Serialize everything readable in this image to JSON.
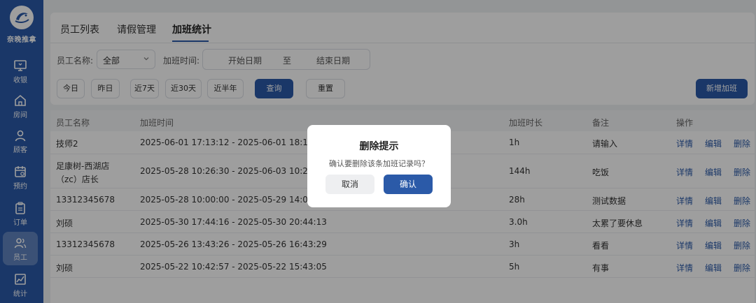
{
  "app": {
    "brand": "奈晚推拿"
  },
  "sidebar": {
    "items": [
      {
        "label": "收银",
        "icon": "monitor-icon"
      },
      {
        "label": "房间",
        "icon": "home-icon"
      },
      {
        "label": "顾客",
        "icon": "user-icon"
      },
      {
        "label": "预约",
        "icon": "calendar-icon"
      },
      {
        "label": "订单",
        "icon": "clipboard-icon"
      },
      {
        "label": "员工",
        "icon": "users-icon",
        "active": true
      },
      {
        "label": "统计",
        "icon": "chart-icon"
      }
    ]
  },
  "tabs": [
    {
      "label": "员工列表"
    },
    {
      "label": "请假管理"
    },
    {
      "label": "加班统计",
      "active": true
    }
  ],
  "filters": {
    "employee_label": "员工名称:",
    "employee_value": "全部",
    "time_label": "加班时间:",
    "start_placeholder": "开始日期",
    "range_sep": "至",
    "end_placeholder": "结束日期",
    "quick": [
      "今日",
      "昨日",
      "近7天",
      "近30天",
      "近半年"
    ],
    "query": "查询",
    "reset": "重置",
    "add": "新增加班"
  },
  "table": {
    "headers": [
      "员工名称",
      "加班时间",
      "加班时长",
      "备注",
      "操作"
    ],
    "actions": [
      "详情",
      "编辑",
      "删除"
    ],
    "rows": [
      {
        "name": "技师2",
        "name2": "",
        "time": "2025-06-01 17:13:12 - 2025-06-01 18:13:16",
        "duration": "1h",
        "note": "请输入"
      },
      {
        "name": "足康树-西湖店",
        "name2": "（zc）店长",
        "time": "2025-05-28 10:26:30 - 2025-06-03 10:26:30",
        "duration": "144h",
        "note": "吃饭"
      },
      {
        "name": "13312345678",
        "name2": "",
        "time": "2025-05-28 10:00:00 - 2025-05-29 14:00:00",
        "duration": "28h",
        "note": "测试数据"
      },
      {
        "name": "刘硕",
        "name2": "",
        "time": "2025-05-30 17:44:16 - 2025-05-30 20:44:13",
        "duration": "3.0h",
        "note": "太累了要休息"
      },
      {
        "name": "13312345678",
        "name2": "",
        "time": "2025-05-26 13:43:26 - 2025-05-26 16:43:29",
        "duration": "3h",
        "note": "看看"
      },
      {
        "name": "刘硕",
        "name2": "",
        "time": "2025-05-22 10:42:57 - 2025-05-22 15:43:05",
        "duration": "5h",
        "note": "有事"
      }
    ]
  },
  "dialog": {
    "title": "删除提示",
    "message": "确认要删除该条加班记录吗？",
    "cancel": "取消",
    "confirm": "确认"
  },
  "colors": {
    "primary": "#2b5aa8",
    "sidebar": "#2b5aa8",
    "overlay": "rgba(0,0,0,0.38)"
  }
}
